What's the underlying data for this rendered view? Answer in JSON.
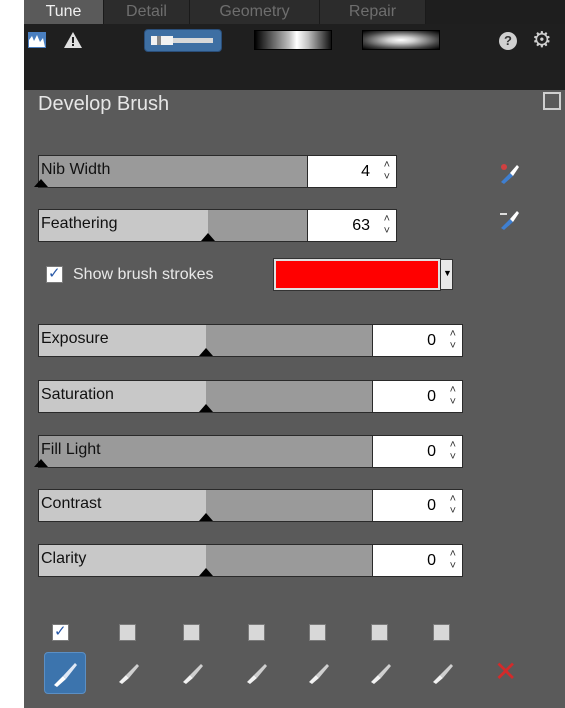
{
  "tabs": [
    {
      "label": "Tune",
      "active": true
    },
    {
      "label": "Detail",
      "active": false
    },
    {
      "label": "Geometry",
      "active": false
    },
    {
      "label": "Repair",
      "active": false
    }
  ],
  "toolbar": {
    "histogram_icon": "histogram-icon",
    "warning_icon": "warning-icon",
    "brush_tool_icon": "brush-tool-icon",
    "linear_gradient_icon": "linear-gradient-icon",
    "radial_gradient_icon": "radial-gradient-icon",
    "help_label": "?",
    "settings_icon": "gear-icon"
  },
  "panel": {
    "title": "Develop Brush"
  },
  "brush_sliders": [
    {
      "label": "Nib Width",
      "value": "4",
      "level": 0.0
    },
    {
      "label": "Feathering",
      "value": "63",
      "level": 0.63
    }
  ],
  "show_strokes": {
    "label": "Show brush strokes",
    "checked": true,
    "color": "#ff0000"
  },
  "adjust_sliders": [
    {
      "label": "Exposure",
      "value": "0",
      "level": 0.5
    },
    {
      "label": "Saturation",
      "value": "0",
      "level": 0.5
    },
    {
      "label": "Fill Light",
      "value": "0",
      "level": 0.0
    },
    {
      "label": "Contrast",
      "value": "0",
      "level": 0.5
    },
    {
      "label": "Clarity",
      "value": "0",
      "level": 0.5
    }
  ],
  "brush_slots": {
    "checked": [
      true,
      false,
      false,
      false,
      false,
      false,
      false
    ],
    "active_index": 0
  },
  "colors": {
    "panel_bg": "#5a5a5a",
    "toolbar_bg": "#1f1f1f",
    "accent": "#3c74ad",
    "delete": "#d42a2a"
  }
}
